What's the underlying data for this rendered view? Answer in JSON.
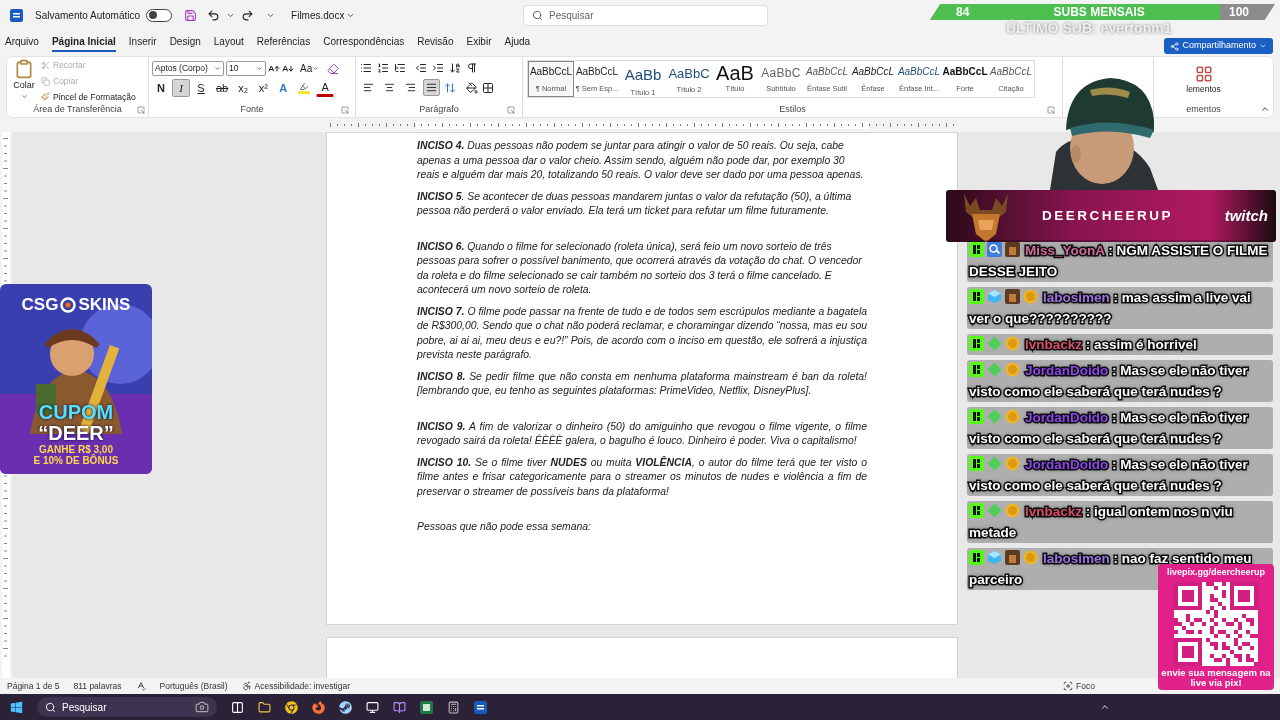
{
  "title_bar": {
    "autosave": {
      "label": "Salvamento Automático",
      "on": false
    },
    "file_name": "Filmes.docx",
    "search": {
      "placeholder": "Pesquisar"
    }
  },
  "menu_tabs": [
    {
      "label": "Arquivo",
      "selected": false
    },
    {
      "label": "Página Inicial",
      "selected": true
    },
    {
      "label": "Inserir",
      "selected": false
    },
    {
      "label": "Design",
      "selected": false
    },
    {
      "label": "Layout",
      "selected": false
    },
    {
      "label": "Referências",
      "selected": false
    },
    {
      "label": "Correspondências",
      "selected": false
    },
    {
      "label": "Revisão",
      "selected": false
    },
    {
      "label": "Exibir",
      "selected": false
    },
    {
      "label": "Ajuda",
      "selected": false
    }
  ],
  "share_button": "Compartilhamento",
  "ribbon": {
    "clipboard": {
      "paste": "Colar",
      "cut": {
        "label": "Recortar",
        "disabled": true
      },
      "copy": {
        "label": "Copiar",
        "disabled": true
      },
      "format_painter": "Pincel de Formatação",
      "group_label": "Área de Transferência"
    },
    "font": {
      "name": "Aptos (Corpo)",
      "size": "10",
      "change_case": "Aa",
      "group_label": "Fonte",
      "buttons": [
        {
          "label": "N",
          "kind": "bold",
          "selected": false
        },
        {
          "label": "I",
          "kind": "italic",
          "selected": true
        },
        {
          "label": "S",
          "kind": "underline",
          "selected": false
        },
        {
          "label": "ab",
          "kind": "strike",
          "selected": false
        },
        {
          "label": "x₂",
          "kind": "sub",
          "selected": false
        },
        {
          "label": "x²",
          "kind": "sup",
          "selected": false
        },
        {
          "label": "A",
          "kind": "effects",
          "selected": false
        },
        {
          "kind": "highlight",
          "selected": false
        },
        {
          "label": "A",
          "kind": "color",
          "selected": false
        }
      ]
    },
    "paragraph": {
      "group_label": "Parágrafo",
      "alignments": [
        {
          "kind": "left",
          "selected": false
        },
        {
          "kind": "center",
          "selected": false
        },
        {
          "kind": "right",
          "selected": false
        },
        {
          "kind": "justify",
          "selected": true
        }
      ]
    },
    "styles": {
      "group_label": "Estilos",
      "items": [
        {
          "preview": "AaBbCcL",
          "name": "¶ Normal",
          "kind": "normal",
          "selected": true
        },
        {
          "preview": "AaBbCcL",
          "name": "¶ Sem Esp...",
          "kind": "normal",
          "selected": false
        },
        {
          "preview": "AaBb",
          "name": "Título 1",
          "kind": "heading1",
          "selected": false
        },
        {
          "preview": "AaBbC",
          "name": "Título 2",
          "kind": "heading2",
          "selected": false
        },
        {
          "preview": "AaB",
          "name": "Título",
          "kind": "title",
          "selected": false
        },
        {
          "preview": "AaBbC",
          "name": "Subtítulo",
          "kind": "subtitle",
          "selected": false
        },
        {
          "preview": "AaBbCcL",
          "name": "Ênfase Sutil",
          "kind": "subtle",
          "selected": false
        },
        {
          "preview": "AaBbCcL",
          "name": "Ênfase",
          "kind": "emphasis",
          "selected": false
        },
        {
          "preview": "AaBbCcL",
          "name": "Ênfase Int...",
          "kind": "intense",
          "selected": false
        },
        {
          "preview": "AaBbCcL",
          "name": "Forte",
          "kind": "strong",
          "selected": false
        },
        {
          "preview": "AaBbCcL",
          "name": "Citação",
          "kind": "quote",
          "selected": false
        }
      ]
    },
    "addins": {
      "label": "lementos",
      "group_label": "ementos"
    }
  },
  "document": {
    "paragraphs": [
      {
        "text": "**INCISO 4.** Duas pessoas não podem se juntar para atingir o valor de 50 reais. Ou seja, cabe apenas a uma pessoa dar o valor cheio. Assim sendo, alguém não pode dar, por exemplo 30 reais e alguém dar mais 20, totalizando 50 reais. O valor deve ser dado por uma pessoa apenas.",
        "justified": false,
        "blank_line_before": false
      },
      {
        "text": "**INCISO 5**. Se acontecer de duas pessoas mandarem juntas o valor da refutação (50), a última pessoa não perderá o valor enviado. Ela terá um ticket para refutar um filme futuramente.",
        "justified": false,
        "blank_line_before": false
      },
      {
        "text": "**INCISO 6.** Quando o filme for selecionado (roleta única), será feio um novo sorteio de três pessoas para sofrer o possível banimento, que ocorrerá através da votação do chat. O vencedor da roleta e do filme selecionado se cair também no sorteio dos 3 terá o filme cancelado. E acontecerá um novo sorteio de roleta.",
        "justified": false,
        "blank_line_before": true
      },
      {
        "text": "**INCISO 7.** O filme pode passar na frente de tudo e de todos sem escrúpulos mediante a bagatela de R$300,00. Sendo que o chat não poderá reclamar, e choramingar dizendo “nossa, mas eu sou pobre, ai ai ai, meu deus e eu?!” Pois, de acordo com o inciso em questão, ele sofrerá a injustiça prevista neste parágrafo.",
        "justified": true,
        "blank_line_before": false
      },
      {
        "text": "**INCISO 8.** Se pedir filme que não consta em nenhuma plataforma mainstream é ban da roleta! [lembrando que, eu tenho as seguintes plataformas: PrimeVideo, Netflix, DisneyPlus].",
        "justified": true,
        "blank_line_before": false
      },
      {
        "text": "**INCISO 9.** A fim de valorizar o dinheiro (50) do amiguinho que revogou o filme vigente, o filme revogado sairá da roleta! ÊÈÈÈ galera, o bagulho é louco. Dinheiro é poder. Viva o capitalismo!",
        "justified": true,
        "blank_line_before": true
      },
      {
        "text": "**INCISO 10.** Se o filme tiver **NUDES** ou muita **VIOLÊNCIA**, o autor do filme terá que ter visto o filme antes e frisar categoricamente para o streamer os minutos de nudes e violência a fim de preservar o streamer de possíveis bans da plataforma!",
        "justified": true,
        "blank_line_before": false
      },
      {
        "text": "Pessoas que não pode essa semana:",
        "justified": false,
        "blank_line_before": true
      }
    ]
  },
  "status_bar": {
    "page": "Página 1 de 5",
    "words": "811 palavras",
    "language": "Português (Brasil)",
    "accessibility": "Acessibilidade: investigar",
    "focus": "Foco"
  },
  "taskbar": {
    "search_placeholder": "Pesquisar"
  },
  "stream_overlay": {
    "subs_goal": {
      "current": "84",
      "label": "SUBS MENSAIS",
      "goal": "100",
      "level": 0.84
    },
    "last_sub": "ÚLTIMO SUB: evertonm1",
    "channel_banner": {
      "name": "DEERCHEERUP",
      "platform": "twitch"
    },
    "chat": [
      {
        "user": "Miss_YoonA",
        "color": "#d46a9e",
        "badges": [
          {
            "kind": "k"
          },
          {
            "kind": "magnifier"
          },
          {
            "kind": "avatar"
          }
        ],
        "text": ": NGM ASSISTE O FILME DESSE JEITO"
      },
      {
        "user": "labosimen",
        "color": "#9c72e0",
        "badges": [
          {
            "kind": "k"
          },
          {
            "kind": "gem"
          },
          {
            "kind": "avatar"
          },
          {
            "kind": "coin"
          }
        ],
        "text": ": mas assim a live vai ver o que??????????"
      },
      {
        "user": "lvnbackz",
        "color": "#d4506c",
        "badges": [
          {
            "kind": "k"
          },
          {
            "kind": "diamond"
          },
          {
            "kind": "coin"
          }
        ],
        "text": ": assim é horrivel"
      },
      {
        "user": "JordanDoido",
        "color": "#8a45e8",
        "badges": [
          {
            "kind": "k"
          },
          {
            "kind": "diamond"
          },
          {
            "kind": "coin"
          }
        ],
        "text": ": Mas se ele não tiver visto como ele saberá que terá nudes ?"
      },
      {
        "user": "JordanDoido",
        "color": "#8a45e8",
        "badges": [
          {
            "kind": "k"
          },
          {
            "kind": "diamond"
          },
          {
            "kind": "coin"
          }
        ],
        "text": ": Mas se ele não tiver visto como ele saberá que terá nudes ?"
      },
      {
        "user": "JordanDoido",
        "color": "#8a45e8",
        "badges": [
          {
            "kind": "k"
          },
          {
            "kind": "diamond"
          },
          {
            "kind": "coin"
          }
        ],
        "text": ": Mas se ele não tiver visto como ele saberá que terá nudes ?"
      },
      {
        "user": "lvnbackz",
        "color": "#d4506c",
        "badges": [
          {
            "kind": "k"
          },
          {
            "kind": "diamond"
          },
          {
            "kind": "coin"
          }
        ],
        "text": ": igual ontem nos n viu metade"
      },
      {
        "user": "labosimen",
        "color": "#9c72e0",
        "badges": [
          {
            "kind": "k"
          },
          {
            "kind": "gem"
          },
          {
            "kind": "avatar"
          },
          {
            "kind": "coin"
          }
        ],
        "text": ": nao faz sentido meu parceiro"
      }
    ],
    "sponsor": {
      "brand_left": "CSG",
      "brand_right": "SKINS",
      "coupon_label": "CUPOM",
      "coupon_code": "“DEER”",
      "bonus_line_1": "GANHE R$ 3,00",
      "bonus_line_2": "E 10% DE BÔNUS"
    },
    "pix_card": {
      "url": "livepix.gg/deercheerup",
      "caption": "envie sua mensagem na live via pix!"
    }
  }
}
